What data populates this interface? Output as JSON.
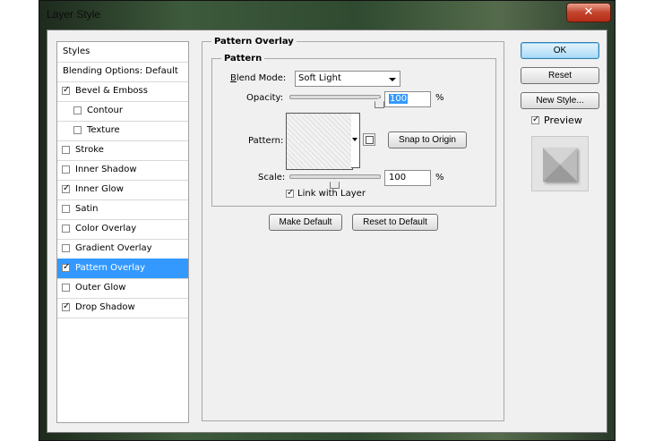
{
  "window": {
    "title": "Layer Style",
    "close_glyph": "✕"
  },
  "styles_panel": {
    "items": [
      {
        "label": "Styles",
        "checkbox": false,
        "checked": false,
        "selected": false
      },
      {
        "label": "Blending Options: Default",
        "checkbox": false,
        "checked": false,
        "selected": false
      },
      {
        "label": "Bevel & Emboss",
        "checkbox": true,
        "checked": true,
        "selected": false
      },
      {
        "label": "Contour",
        "checkbox": true,
        "checked": false,
        "selected": false
      },
      {
        "label": "Texture",
        "checkbox": true,
        "checked": false,
        "selected": false
      },
      {
        "label": "Stroke",
        "checkbox": true,
        "checked": false,
        "selected": false
      },
      {
        "label": "Inner Shadow",
        "checkbox": true,
        "checked": false,
        "selected": false
      },
      {
        "label": "Inner Glow",
        "checkbox": true,
        "checked": true,
        "selected": false
      },
      {
        "label": "Satin",
        "checkbox": true,
        "checked": false,
        "selected": false
      },
      {
        "label": "Color Overlay",
        "checkbox": true,
        "checked": false,
        "selected": false
      },
      {
        "label": "Gradient Overlay",
        "checkbox": true,
        "checked": false,
        "selected": false
      },
      {
        "label": "Pattern Overlay",
        "checkbox": true,
        "checked": true,
        "selected": true
      },
      {
        "label": "Outer Glow",
        "checkbox": true,
        "checked": false,
        "selected": false
      },
      {
        "label": "Drop Shadow",
        "checkbox": true,
        "checked": true,
        "selected": false
      }
    ]
  },
  "pattern_overlay": {
    "group_title": "Pattern Overlay",
    "subgroup_title": "Pattern",
    "blend_mode_label": "Blend Mode:",
    "blend_mode_value": "Soft Light",
    "opacity_label": "Opacity:",
    "opacity_value": "100",
    "opacity_level_percent": 100,
    "percent_sign": "%",
    "pattern_label": "Pattern:",
    "snap_button": "Snap to Origin",
    "scale_label": "Scale:",
    "scale_value": "100",
    "scale_level_percent": 100,
    "link_label": "Link with Layer",
    "link_checked": true,
    "make_default_button": "Make Default",
    "reset_default_button": "Reset to Default"
  },
  "actions": {
    "ok": "OK",
    "reset": "Reset",
    "new_style": "New Style...",
    "preview_label": "Preview",
    "preview_checked": true
  },
  "colors": {
    "selection": "#3399ff",
    "ok_button": "#a9daf7",
    "close_button": "#c4442c"
  }
}
